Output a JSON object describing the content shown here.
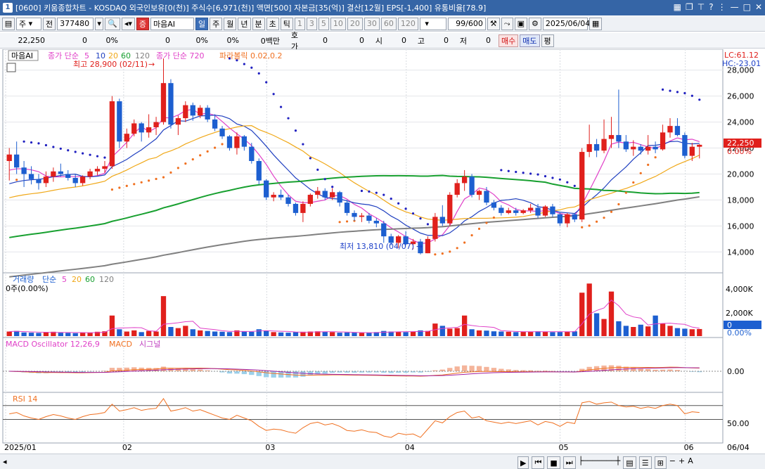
{
  "title": {
    "num": "1",
    "text": "[0600] 키움종합차트 - KOSDAQ 외국인보유[0(천)] 주식수[6,971(천)] 액면[500] 자본금[35(억)] 결산[12월] EPS[-1,400] 유통비율[78.9]"
  },
  "toolbar": {
    "period": "주",
    "prev": "전",
    "code": "377480",
    "signal": "증",
    "mode": "마음AI",
    "day": "일",
    "periods": [
      "주",
      "월",
      "년",
      "분",
      "초",
      "틱"
    ],
    "minutes": [
      "1",
      "3",
      "5",
      "10",
      "20",
      "30",
      "60",
      "120"
    ],
    "count": "99/600",
    "date": "2025/06/04"
  },
  "quote": {
    "price": "22,250",
    "change": "0",
    "rate": "0%",
    "vol": "0",
    "volrate": "0%",
    "volrate2": "0%",
    "amount": "0백만",
    "hoga_label": "호가",
    "hoga": "0",
    "v2": "0",
    "si_label": "시",
    "si": "0",
    "go_label": "고",
    "go": "0",
    "jeo_label": "저",
    "jeo": "0",
    "buy": "매수",
    "sell": "매도",
    "pyeong": "평"
  },
  "legend": {
    "tag": "마음AI",
    "ma_label": "종가 단순",
    "ma5": "5",
    "ma10": "10",
    "ma20": "20",
    "ma60": "60",
    "ma120": "120",
    "ma720_label": "종가 단순 720",
    "sar_label": "파라볼릭 0.02,0.2",
    "high_note": "최고 28,900 (02/11)",
    "low_note": "최저 13,810 (04/07)",
    "lc": "LC:61.12",
    "hc": "HC:-23.01",
    "price_tag": "22,250",
    "price_pct": "0.00%"
  },
  "volume": {
    "title": "거래량",
    "ma_label": "단순",
    "ma5": "5",
    "ma20": "20",
    "ma60": "60",
    "ma120": "120",
    "value": "0주(0.00%)",
    "tag": "0",
    "tag_pct": "0.00%",
    "ticks": [
      "4,000K",
      "2,000K"
    ]
  },
  "macd": {
    "osc_label": "MACD Oscillator 12,26,9",
    "macd_label": "MACD",
    "sig_label": "시그널",
    "tick": "0.00"
  },
  "rsi": {
    "label": "RSI 14",
    "tick": "50.00"
  },
  "price_ticks": [
    "28,000",
    "26,000",
    "24,000",
    "22,000",
    "20,000",
    "18,000",
    "16,000",
    "14,000"
  ],
  "x_labels": [
    "2025/01",
    "02",
    "03",
    "04",
    "05",
    "06",
    "06/04"
  ],
  "colors": {
    "up": "#e0201c",
    "down": "#1d5fd0",
    "ma5": "#e040c8",
    "ma10": "#2040c0",
    "ma20": "#f0a818",
    "ma60": "#18a030",
    "ma120": "#808080",
    "sar": "#f07020",
    "sar_dn": "#2020c0"
  },
  "chart_data": {
    "type": "candlestick",
    "series": [
      {
        "name": "price_ohlc",
        "values": [
          [
            21000,
            22000,
            19500,
            21500
          ],
          [
            21500,
            22500,
            20000,
            20500
          ],
          [
            20500,
            21000,
            19000,
            20000
          ],
          [
            20000,
            20600,
            19200,
            19600
          ],
          [
            19600,
            20000,
            18800,
            19300
          ],
          [
            19300,
            20200,
            19000,
            19800
          ],
          [
            19800,
            20500,
            19400,
            20200
          ],
          [
            20200,
            20800,
            19800,
            20000
          ],
          [
            20000,
            20300,
            19500,
            19700
          ],
          [
            19700,
            20000,
            19000,
            19300
          ],
          [
            19300,
            19900,
            19100,
            19800
          ],
          [
            19800,
            20400,
            19600,
            20200
          ],
          [
            20200,
            20600,
            19900,
            20400
          ],
          [
            20400,
            21000,
            20100,
            20600
          ],
          [
            20600,
            26000,
            20400,
            25600
          ],
          [
            25600,
            25800,
            22000,
            22500
          ],
          [
            22500,
            23500,
            22000,
            23100
          ],
          [
            23100,
            24200,
            22900,
            23900
          ],
          [
            23900,
            24000,
            22500,
            23200
          ],
          [
            23200,
            24600,
            22800,
            23600
          ],
          [
            23600,
            24400,
            23000,
            24000
          ],
          [
            24000,
            28900,
            23800,
            27000
          ],
          [
            27000,
            27300,
            23500,
            23800
          ],
          [
            23800,
            24500,
            23000,
            24300
          ],
          [
            24300,
            25600,
            24000,
            25300
          ],
          [
            25300,
            25500,
            24100,
            24500
          ],
          [
            24500,
            25300,
            24300,
            25100
          ],
          [
            25100,
            25300,
            24000,
            24200
          ],
          [
            24200,
            24600,
            23300,
            23500
          ],
          [
            23500,
            23700,
            22700,
            22900
          ],
          [
            22900,
            23000,
            21800,
            22000
          ],
          [
            22000,
            23200,
            21500,
            22900
          ],
          [
            22900,
            23000,
            21800,
            22100
          ],
          [
            22100,
            22400,
            20800,
            21000
          ],
          [
            21000,
            21200,
            19200,
            19500
          ],
          [
            19500,
            19600,
            18000,
            18200
          ],
          [
            18200,
            18600,
            17900,
            18400
          ],
          [
            18400,
            18800,
            18000,
            18200
          ],
          [
            18200,
            18400,
            17500,
            17700
          ],
          [
            17700,
            17800,
            16800,
            17000
          ],
          [
            17000,
            17900,
            16300,
            17700
          ],
          [
            17700,
            18500,
            17500,
            18400
          ],
          [
            18400,
            19000,
            18100,
            18700
          ],
          [
            18700,
            18900,
            18000,
            18200
          ],
          [
            18200,
            18900,
            18000,
            18600
          ],
          [
            18600,
            18700,
            17500,
            17800
          ],
          [
            17800,
            18000,
            16800,
            17000
          ],
          [
            17000,
            17200,
            16400,
            16700
          ],
          [
            16700,
            17000,
            16300,
            16800
          ],
          [
            16800,
            17000,
            16200,
            16400
          ],
          [
            16400,
            16600,
            15900,
            16200
          ],
          [
            16200,
            16400,
            14700,
            15200
          ],
          [
            15200,
            15400,
            14500,
            14700
          ],
          [
            14700,
            15300,
            14300,
            15200
          ],
          [
            15200,
            15600,
            14500,
            14600
          ],
          [
            14600,
            15000,
            14200,
            14800
          ],
          [
            14800,
            15000,
            13810,
            13900
          ],
          [
            13900,
            15200,
            13900,
            15000
          ],
          [
            15000,
            17000,
            14800,
            16700
          ],
          [
            16700,
            17600,
            16000,
            16200
          ],
          [
            16200,
            18600,
            16000,
            18400
          ],
          [
            18400,
            19600,
            18200,
            19300
          ],
          [
            19300,
            20300,
            18700,
            19800
          ],
          [
            19800,
            20000,
            18200,
            18400
          ],
          [
            18400,
            18800,
            18000,
            18700
          ],
          [
            18700,
            19000,
            17600,
            17800
          ],
          [
            17800,
            18000,
            17200,
            17400
          ],
          [
            17400,
            17600,
            16800,
            17000
          ],
          [
            17000,
            17400,
            16900,
            17200
          ],
          [
            17200,
            17400,
            16800,
            17000
          ],
          [
            17000,
            17300,
            16900,
            17200
          ],
          [
            17200,
            17700,
            17000,
            17400
          ],
          [
            17400,
            17700,
            16600,
            16800
          ],
          [
            16800,
            17600,
            16700,
            17500
          ],
          [
            17500,
            17700,
            16700,
            16900
          ],
          [
            16900,
            17000,
            16000,
            16200
          ],
          [
            16200,
            17000,
            15900,
            16900
          ],
          [
            16900,
            17000,
            16300,
            16500
          ],
          [
            16500,
            22000,
            16300,
            21700
          ],
          [
            21700,
            23800,
            21300,
            22300
          ],
          [
            22300,
            22700,
            21300,
            21800
          ],
          [
            21800,
            24200,
            21600,
            22700
          ],
          [
            22700,
            24400,
            22000,
            23000
          ],
          [
            23000,
            26500,
            22000,
            22500
          ],
          [
            22500,
            23000,
            21700,
            21900
          ],
          [
            21900,
            22600,
            21400,
            22100
          ],
          [
            22100,
            22300,
            21500,
            21800
          ],
          [
            21800,
            23000,
            21500,
            22100
          ],
          [
            22100,
            22500,
            21600,
            21900
          ],
          [
            21900,
            23800,
            21800,
            23200
          ],
          [
            23200,
            24300,
            22800,
            23700
          ],
          [
            23700,
            24300,
            22900,
            23000
          ],
          [
            23000,
            23200,
            21200,
            21400
          ],
          [
            21400,
            22400,
            21000,
            22100
          ],
          [
            22100,
            22300,
            21200,
            22250
          ]
        ]
      },
      {
        "name": "volume_k",
        "values": [
          400,
          450,
          320,
          300,
          280,
          350,
          380,
          300,
          280,
          260,
          300,
          320,
          380,
          420,
          1800,
          600,
          400,
          500,
          350,
          450,
          400,
          3500,
          800,
          700,
          900,
          600,
          500,
          450,
          400,
          380,
          350,
          500,
          420,
          380,
          600,
          480,
          350,
          320,
          300,
          350,
          380,
          400,
          420,
          380,
          350,
          300,
          320,
          300,
          280,
          300,
          350,
          450,
          400,
          380,
          350,
          400,
          500,
          450,
          1100,
          900,
          650,
          700,
          1800,
          600,
          500,
          480,
          420,
          400,
          380,
          350,
          380,
          400,
          420,
          380,
          350,
          360,
          400,
          420,
          3800,
          4600,
          2000,
          1500,
          3900,
          1300,
          900,
          800,
          1000,
          850,
          1800,
          1100,
          900,
          700,
          650,
          600,
          620
        ]
      },
      {
        "name": "rsi",
        "values": [
          58,
          60,
          55,
          52,
          50,
          54,
          57,
          55,
          52,
          50,
          54,
          57,
          58,
          60,
          72,
          62,
          64,
          67,
          63,
          65,
          66,
          80,
          62,
          64,
          67,
          62,
          64,
          60,
          56,
          52,
          50,
          56,
          52,
          48,
          40,
          34,
          36,
          35,
          32,
          30,
          38,
          44,
          46,
          42,
          44,
          40,
          34,
          33,
          35,
          32,
          31,
          26,
          24,
          30,
          28,
          29,
          24,
          36,
          48,
          45,
          54,
          60,
          62,
          52,
          54,
          48,
          46,
          44,
          46,
          44,
          46,
          48,
          42,
          47,
          45,
          40,
          46,
          44,
          74,
          76,
          72,
          74,
          75,
          70,
          68,
          69,
          66,
          68,
          66,
          70,
          72,
          70,
          58,
          61,
          60
        ]
      }
    ],
    "y_range": [
      12500,
      29500
    ],
    "title": "",
    "xlabel": "",
    "ylabel": ""
  }
}
